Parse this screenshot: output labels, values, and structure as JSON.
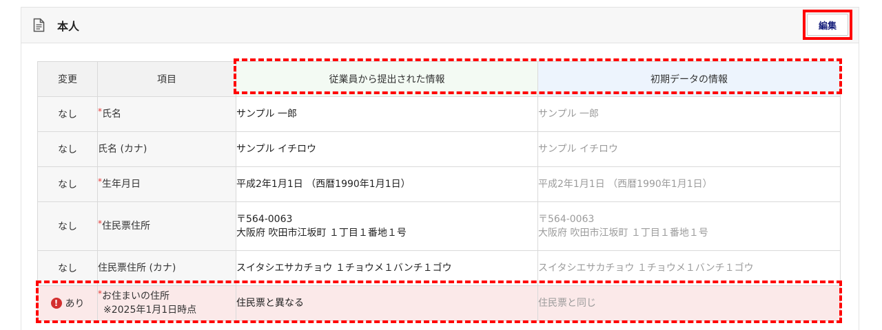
{
  "section": {
    "title": "本人",
    "edit_label": "編集"
  },
  "table": {
    "headers": {
      "change": "変更",
      "item": "項目",
      "employee": "従業員から提出された情報",
      "initial": "初期データの情報"
    },
    "required_mark": "*",
    "rows": [
      {
        "change": "なし",
        "item": "氏名",
        "employee_value": "サンプル 一郎",
        "initial_value": "サンプル 一郎"
      },
      {
        "change": "なし",
        "item": "氏名 (カナ)",
        "employee_value": "サンプル イチロウ",
        "initial_value": "サンプル イチロウ"
      },
      {
        "change": "なし",
        "item": "生年月日",
        "employee_value": "平成2年1月1日 （西暦1990年1月1日）",
        "initial_value": "平成2年1月1日 （西暦1990年1月1日）"
      },
      {
        "change": "なし",
        "item": "住民票住所",
        "employee_value_line1": "〒564-0063",
        "employee_value_line2": "大阪府 吹田市江坂町 １丁目１番地１号",
        "initial_value_line1": "〒564-0063",
        "initial_value_line2": "大阪府 吹田市江坂町 １丁目１番地１号"
      },
      {
        "change": "なし",
        "item": "住民票住所 (カナ)",
        "employee_value": "スイタシエサカチョウ １チョウメ１バンチ１ゴウ",
        "initial_value": "スイタシエサカチョウ １チョウメ１バンチ１ゴウ"
      },
      {
        "change": "あり",
        "item_line1": "お住まいの住所",
        "item_line2": "※2025年1月1日時点",
        "employee_value": "住民票と異なる",
        "initial_value": "住民票と同じ"
      }
    ]
  },
  "alert_icon_glyph": "!",
  "colors": {
    "required": "#e53935",
    "alert_icon": "#d32f2f",
    "alert_row_bg": "#fbe9e9",
    "highlight": "#ff0000",
    "edit_text": "#1a237e",
    "employee_header_bg": "#f3faf3",
    "initial_header_bg": "#edf4fd"
  },
  "icons": {
    "section": "document-icon",
    "alert": "exclamation-circle-icon"
  }
}
